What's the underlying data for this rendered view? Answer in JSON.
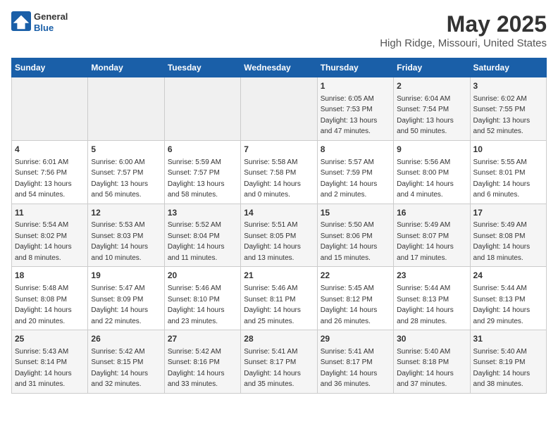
{
  "header": {
    "logo": {
      "line1": "General",
      "line2": "Blue"
    },
    "title": "May 2025",
    "subtitle": "High Ridge, Missouri, United States"
  },
  "weekdays": [
    "Sunday",
    "Monday",
    "Tuesday",
    "Wednesday",
    "Thursday",
    "Friday",
    "Saturday"
  ],
  "weeks": [
    [
      {
        "day": "",
        "info": ""
      },
      {
        "day": "",
        "info": ""
      },
      {
        "day": "",
        "info": ""
      },
      {
        "day": "",
        "info": ""
      },
      {
        "day": "1",
        "info": "Sunrise: 6:05 AM\nSunset: 7:53 PM\nDaylight: 13 hours\nand 47 minutes."
      },
      {
        "day": "2",
        "info": "Sunrise: 6:04 AM\nSunset: 7:54 PM\nDaylight: 13 hours\nand 50 minutes."
      },
      {
        "day": "3",
        "info": "Sunrise: 6:02 AM\nSunset: 7:55 PM\nDaylight: 13 hours\nand 52 minutes."
      }
    ],
    [
      {
        "day": "4",
        "info": "Sunrise: 6:01 AM\nSunset: 7:56 PM\nDaylight: 13 hours\nand 54 minutes."
      },
      {
        "day": "5",
        "info": "Sunrise: 6:00 AM\nSunset: 7:57 PM\nDaylight: 13 hours\nand 56 minutes."
      },
      {
        "day": "6",
        "info": "Sunrise: 5:59 AM\nSunset: 7:57 PM\nDaylight: 13 hours\nand 58 minutes."
      },
      {
        "day": "7",
        "info": "Sunrise: 5:58 AM\nSunset: 7:58 PM\nDaylight: 14 hours\nand 0 minutes."
      },
      {
        "day": "8",
        "info": "Sunrise: 5:57 AM\nSunset: 7:59 PM\nDaylight: 14 hours\nand 2 minutes."
      },
      {
        "day": "9",
        "info": "Sunrise: 5:56 AM\nSunset: 8:00 PM\nDaylight: 14 hours\nand 4 minutes."
      },
      {
        "day": "10",
        "info": "Sunrise: 5:55 AM\nSunset: 8:01 PM\nDaylight: 14 hours\nand 6 minutes."
      }
    ],
    [
      {
        "day": "11",
        "info": "Sunrise: 5:54 AM\nSunset: 8:02 PM\nDaylight: 14 hours\nand 8 minutes."
      },
      {
        "day": "12",
        "info": "Sunrise: 5:53 AM\nSunset: 8:03 PM\nDaylight: 14 hours\nand 10 minutes."
      },
      {
        "day": "13",
        "info": "Sunrise: 5:52 AM\nSunset: 8:04 PM\nDaylight: 14 hours\nand 11 minutes."
      },
      {
        "day": "14",
        "info": "Sunrise: 5:51 AM\nSunset: 8:05 PM\nDaylight: 14 hours\nand 13 minutes."
      },
      {
        "day": "15",
        "info": "Sunrise: 5:50 AM\nSunset: 8:06 PM\nDaylight: 14 hours\nand 15 minutes."
      },
      {
        "day": "16",
        "info": "Sunrise: 5:49 AM\nSunset: 8:07 PM\nDaylight: 14 hours\nand 17 minutes."
      },
      {
        "day": "17",
        "info": "Sunrise: 5:49 AM\nSunset: 8:08 PM\nDaylight: 14 hours\nand 18 minutes."
      }
    ],
    [
      {
        "day": "18",
        "info": "Sunrise: 5:48 AM\nSunset: 8:08 PM\nDaylight: 14 hours\nand 20 minutes."
      },
      {
        "day": "19",
        "info": "Sunrise: 5:47 AM\nSunset: 8:09 PM\nDaylight: 14 hours\nand 22 minutes."
      },
      {
        "day": "20",
        "info": "Sunrise: 5:46 AM\nSunset: 8:10 PM\nDaylight: 14 hours\nand 23 minutes."
      },
      {
        "day": "21",
        "info": "Sunrise: 5:46 AM\nSunset: 8:11 PM\nDaylight: 14 hours\nand 25 minutes."
      },
      {
        "day": "22",
        "info": "Sunrise: 5:45 AM\nSunset: 8:12 PM\nDaylight: 14 hours\nand 26 minutes."
      },
      {
        "day": "23",
        "info": "Sunrise: 5:44 AM\nSunset: 8:13 PM\nDaylight: 14 hours\nand 28 minutes."
      },
      {
        "day": "24",
        "info": "Sunrise: 5:44 AM\nSunset: 8:13 PM\nDaylight: 14 hours\nand 29 minutes."
      }
    ],
    [
      {
        "day": "25",
        "info": "Sunrise: 5:43 AM\nSunset: 8:14 PM\nDaylight: 14 hours\nand 31 minutes."
      },
      {
        "day": "26",
        "info": "Sunrise: 5:42 AM\nSunset: 8:15 PM\nDaylight: 14 hours\nand 32 minutes."
      },
      {
        "day": "27",
        "info": "Sunrise: 5:42 AM\nSunset: 8:16 PM\nDaylight: 14 hours\nand 33 minutes."
      },
      {
        "day": "28",
        "info": "Sunrise: 5:41 AM\nSunset: 8:17 PM\nDaylight: 14 hours\nand 35 minutes."
      },
      {
        "day": "29",
        "info": "Sunrise: 5:41 AM\nSunset: 8:17 PM\nDaylight: 14 hours\nand 36 minutes."
      },
      {
        "day": "30",
        "info": "Sunrise: 5:40 AM\nSunset: 8:18 PM\nDaylight: 14 hours\nand 37 minutes."
      },
      {
        "day": "31",
        "info": "Sunrise: 5:40 AM\nSunset: 8:19 PM\nDaylight: 14 hours\nand 38 minutes."
      }
    ]
  ]
}
